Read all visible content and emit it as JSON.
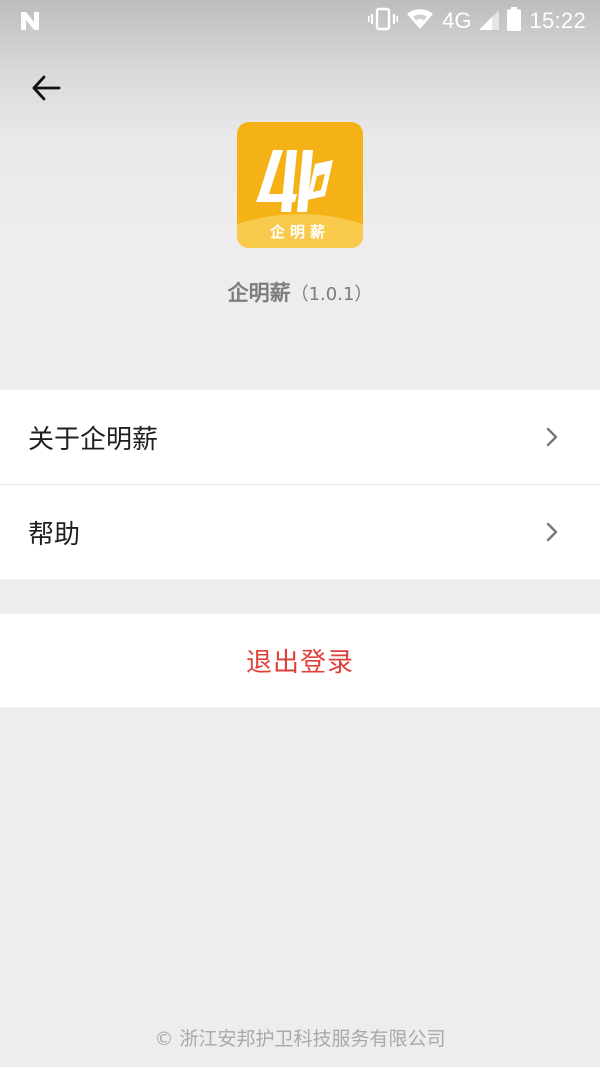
{
  "status_bar": {
    "left_icon": "n-notification-icon",
    "network": "4G",
    "time": "15:22"
  },
  "header": {
    "back_icon": "back-arrow-icon"
  },
  "app": {
    "logo_text": "企明薪",
    "name": "企明薪",
    "version": "（1.0.1）",
    "logo_color": "#f4b217"
  },
  "menu": {
    "items": [
      {
        "label": "关于企明薪",
        "icon": "chevron-right-icon"
      },
      {
        "label": "帮助",
        "icon": "chevron-right-icon"
      }
    ]
  },
  "logout": {
    "label": "退出登录",
    "color": "#e0403a"
  },
  "footer": {
    "copyright": "© 浙江安邦护卫科技服务有限公司"
  }
}
